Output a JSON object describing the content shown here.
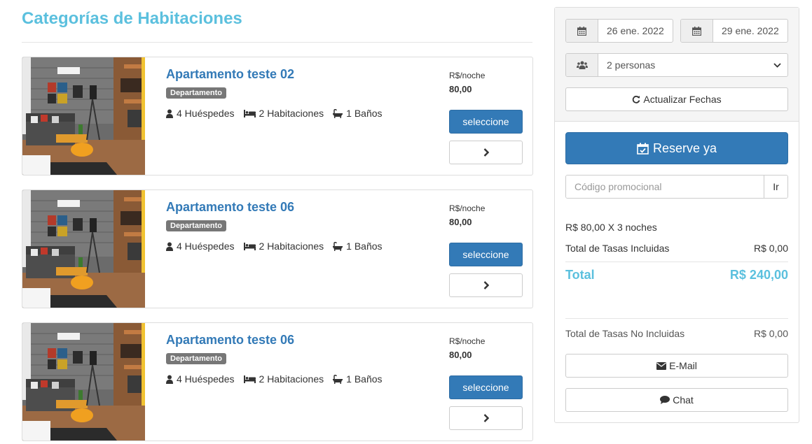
{
  "page": {
    "title": "Categorías de Habitaciones"
  },
  "rooms": [
    {
      "name": "Apartamento teste 02",
      "badge": "Departamento",
      "guests": "4 Huéspedes",
      "bedrooms": "2 Habitaciones",
      "bathrooms": "1 Baños",
      "price_label": "R$/noche",
      "price": "80,00",
      "select_label": "seleccione"
    },
    {
      "name": "Apartamento teste 06",
      "badge": "Departamento",
      "guests": "4 Huéspedes",
      "bedrooms": "2 Habitaciones",
      "bathrooms": "1 Baños",
      "price_label": "R$/noche",
      "price": "80,00",
      "select_label": "seleccione"
    },
    {
      "name": "Apartamento teste 06",
      "badge": "Departamento",
      "guests": "4 Huéspedes",
      "bedrooms": "2 Habitaciones",
      "bathrooms": "1 Baños",
      "price_label": "R$/noche",
      "price": "80,00",
      "select_label": "seleccione"
    }
  ],
  "booking": {
    "checkin": "26 ene. 2022",
    "checkout": "29 ene. 2022",
    "guests": "2 personas",
    "update_label": "Actualizar Fechas",
    "reserve_label": "Reserve ya",
    "promo_placeholder": "Código promocional",
    "promo_go": "Ir",
    "nights_line": "R$ 80,00 X 3 noches",
    "taxes_included_label": "Total de Tasas Incluidas",
    "taxes_included_value": "R$ 0,00",
    "total_label": "Total",
    "total_value": "R$ 240,00",
    "taxes_excluded_label": "Total de Tasas No Incluidas",
    "taxes_excluded_value": "R$ 0,00",
    "email_label": "E-Mail",
    "chat_label": "Chat"
  },
  "colors": {
    "title": "#5bc0de",
    "primary": "#337ab7",
    "badge": "#777777"
  },
  "icons": [
    "calendar-icon",
    "users-icon",
    "refresh-icon",
    "calendar-check-icon",
    "user-icon",
    "bed-icon",
    "bath-icon",
    "chevron-right-icon",
    "envelope-icon",
    "comment-icon",
    "chevron-down-icon"
  ]
}
